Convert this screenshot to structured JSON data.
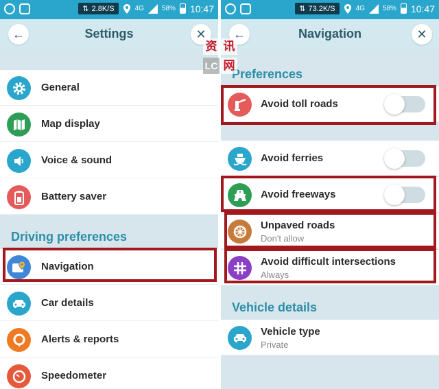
{
  "left": {
    "status": {
      "speed": "2.8K/S",
      "network": "4G",
      "battery": "58%",
      "time": "10:47"
    },
    "header": {
      "title": "Settings"
    },
    "items": [
      {
        "label": "General",
        "icon": "gear-icon",
        "color": "#2aa6cc"
      },
      {
        "label": "Map display",
        "icon": "map-icon",
        "color": "#2e9d55"
      },
      {
        "label": "Voice & sound",
        "icon": "speaker-icon",
        "color": "#2aa6cc"
      },
      {
        "label": "Battery saver",
        "icon": "battery-icon",
        "color": "#e55a5a"
      }
    ],
    "section": "Driving preferences",
    "driving_items": [
      {
        "label": "Navigation",
        "icon": "navigation-map-icon",
        "color": "#3d86d8"
      },
      {
        "label": "Car details",
        "icon": "car-icon",
        "color": "#2aa6cc"
      },
      {
        "label": "Alerts & reports",
        "icon": "alert-icon",
        "color": "#ef7a22"
      },
      {
        "label": "Speedometer",
        "icon": "speedometer-icon",
        "color": "#e55a3a"
      }
    ]
  },
  "right": {
    "status": {
      "speed": "73.2K/S",
      "network": "4G",
      "battery": "58%",
      "time": "10:47"
    },
    "header": {
      "title": "Navigation"
    },
    "section": "Preferences",
    "items": [
      {
        "label": "Avoid toll roads",
        "icon": "toll-icon",
        "color": "#e55a5a",
        "toggle": false
      },
      {
        "label": "Avoid ferries",
        "icon": "ferry-icon",
        "color": "#2aa6cc",
        "toggle": false
      },
      {
        "label": "Avoid freeways",
        "icon": "freeway-icon",
        "color": "#2e9d55",
        "toggle": false
      },
      {
        "label": "Unpaved roads",
        "sub": "Don't allow",
        "icon": "wheel-icon",
        "color": "#c87a3a"
      },
      {
        "label": "Avoid difficult intersections",
        "sub": "Always",
        "icon": "intersection-icon",
        "color": "#8a3fc5"
      }
    ],
    "section2": "Vehicle details",
    "vehicle": {
      "label": "Vehicle type",
      "sub": "Private",
      "icon": "car-icon",
      "color": "#2aa6cc"
    }
  },
  "watermark": {
    "c1": "资",
    "c2": "讯",
    "c3": "LC",
    "c4": "网"
  },
  "highlight_color": "#a1191e"
}
